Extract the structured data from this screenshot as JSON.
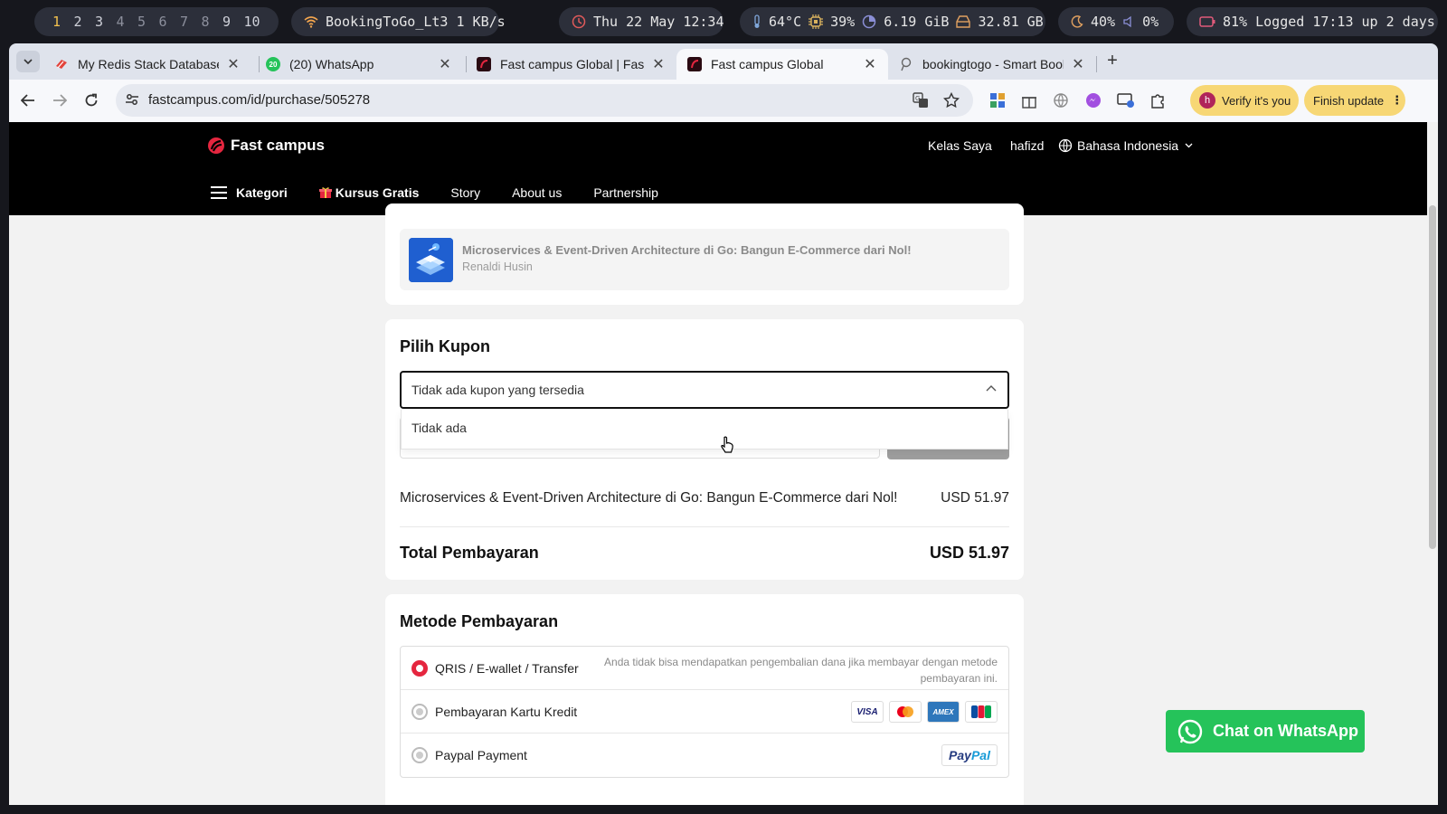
{
  "system_bar": {
    "workspaces": [
      "1",
      "2",
      "3",
      "4",
      "5",
      "6",
      "7",
      "8",
      "9",
      "10"
    ],
    "network": "BookingToGo_Lt3 1 KB/s",
    "datetime": "Thu 22 May 12:34",
    "temperature": "64°C",
    "cpu": "39%",
    "memory": "6.19 GiB",
    "disk": "32.81 GB",
    "brightness": "40%",
    "volume": "0%",
    "battery_uptime": "81% Logged 17:13 up 2 days"
  },
  "browser": {
    "tabs": [
      {
        "label": "My Redis Stack Database - B",
        "icon": "redis-icon",
        "active": false
      },
      {
        "label": "(20) WhatsApp",
        "icon": "whatsapp-icon",
        "active": false
      },
      {
        "label": "Fast campus Global | Fast ca",
        "icon": "fastcampus-icon",
        "active": false
      },
      {
        "label": "Fast campus Global",
        "icon": "fastcampus-icon",
        "active": true
      },
      {
        "label": "bookingtogo - Smart Bookin",
        "icon": "bookingtogo-icon",
        "active": false
      }
    ],
    "url": "fastcampus.com/id/purchase/505278",
    "verify_label": "Verify it's you",
    "verify_avatar": "h",
    "finish_update_label": "Finish update"
  },
  "site": {
    "logo_text": "Fast campus",
    "header_links": {
      "my_classes": "Kelas Saya",
      "username": "hafizd",
      "language": "Bahasa Indonesia"
    },
    "nav": {
      "category": "Kategori",
      "free_courses": "Kursus Gratis",
      "story": "Story",
      "about": "About us",
      "partnership": "Partnership"
    }
  },
  "course": {
    "title": "Microservices & Event-Driven Architecture di Go: Bangun E-Commerce dari Nol!",
    "author": "Renaldi Husin"
  },
  "coupon": {
    "heading": "Pilih Kupon",
    "selected": "Tidak ada kupon yang tersedia",
    "dropdown_option": "Tidak ada"
  },
  "summary": {
    "item_title": "Microservices & Event-Driven Architecture di Go: Bangun E-Commerce dari Nol!",
    "item_price": "USD 51.97",
    "total_label": "Total Pembayaran",
    "total_price": "USD 51.97"
  },
  "payment": {
    "heading": "Metode Pembayaran",
    "methods": [
      {
        "label": "QRIS / E-wallet / Transfer",
        "note": "Anda tidak bisa mendapatkan pengembalian dana jika membayar dengan metode pembayaran ini.",
        "selected": true
      },
      {
        "label": "Pembayaran Kartu Kredit",
        "selected": false,
        "card_brands": [
          "VISA",
          "Mastercard",
          "AMEX",
          "JCB"
        ]
      },
      {
        "label": "Paypal Payment",
        "selected": false,
        "brand": "PayPal"
      }
    ]
  },
  "whatsapp_button": "Chat on WhatsApp",
  "colors": {
    "accent_red": "#e5263f",
    "whatsapp_green": "#25c35a",
    "header_black": "#000000"
  }
}
